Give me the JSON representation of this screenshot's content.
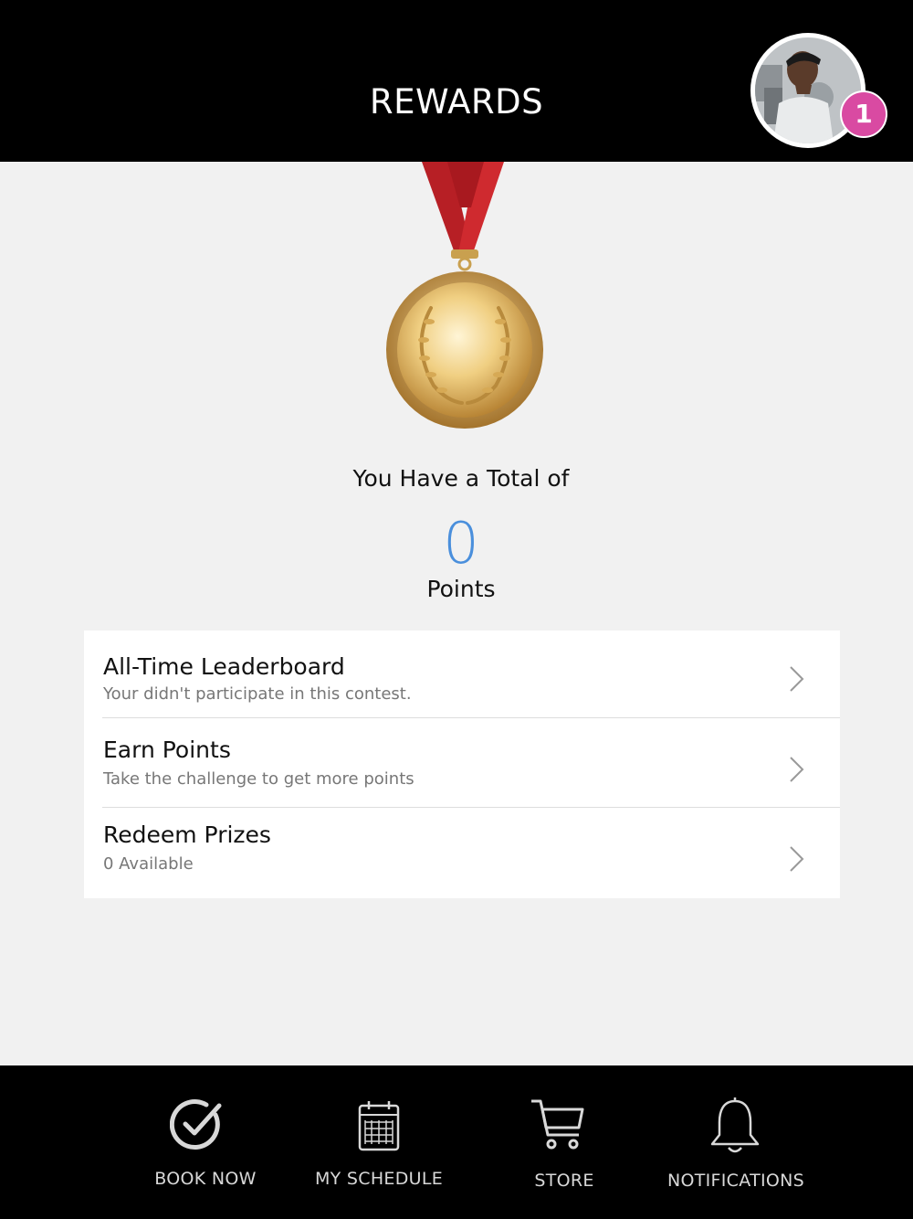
{
  "header": {
    "title": "REWARDS",
    "notification_count": "1"
  },
  "summary": {
    "label": "You Have a Total of",
    "points": "0",
    "unit": "Points"
  },
  "menu": [
    {
      "title": "All-Time Leaderboard",
      "subtitle": "Your didn't participate in this contest."
    },
    {
      "title": "Earn Points",
      "subtitle": "Take the challenge to get more points"
    },
    {
      "title": "Redeem Prizes",
      "subtitle": "0 Available"
    }
  ],
  "tabs": [
    {
      "label": "BOOK NOW",
      "icon": "check-circle-icon"
    },
    {
      "label": "MY SCHEDULE",
      "icon": "calendar-icon"
    },
    {
      "label": "STORE",
      "icon": "cart-icon"
    },
    {
      "label": "NOTIFICATIONS",
      "icon": "bell-icon"
    }
  ],
  "colors": {
    "accent": "#4a8fdc",
    "badge": "#d94aa2",
    "bar": "#000000"
  }
}
